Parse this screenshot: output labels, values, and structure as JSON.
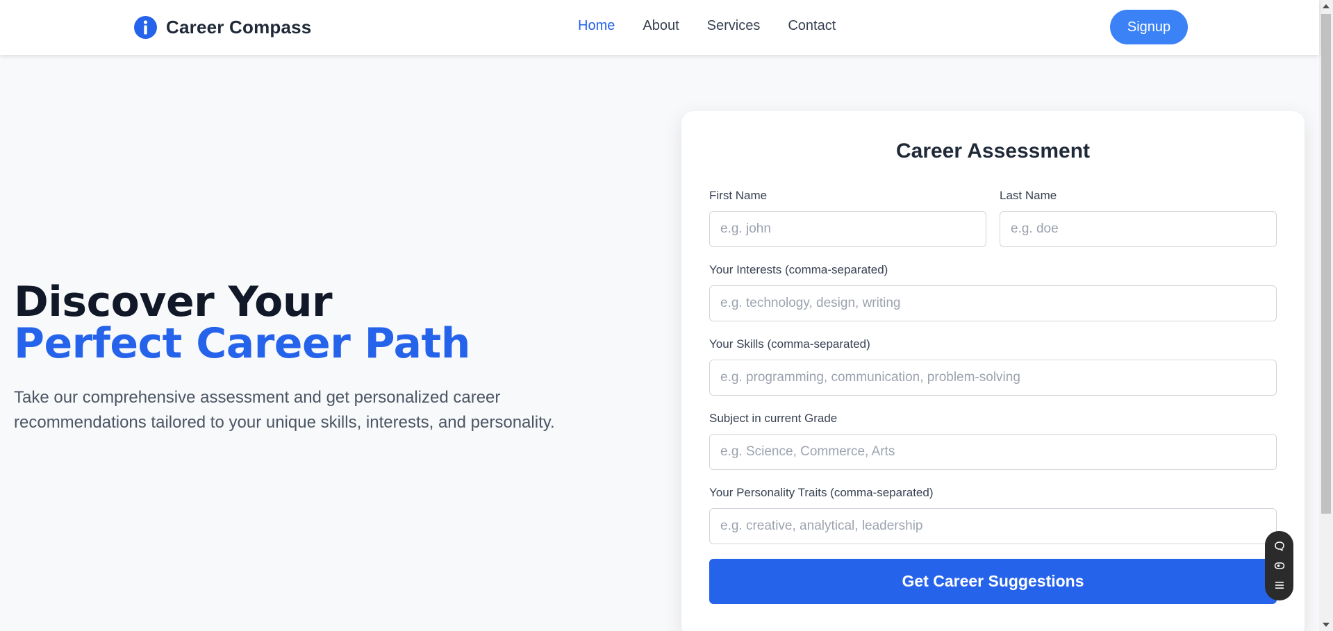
{
  "brand": {
    "name": "Career Compass",
    "accent": "#2563eb"
  },
  "nav": {
    "items": [
      "Home",
      "About",
      "Services",
      "Contact"
    ],
    "active": "Home"
  },
  "signup_label": "Signup",
  "hero": {
    "title_line1": "Discover Your",
    "title_line2": "Perfect Career Path",
    "description": "Take our comprehensive assessment and get personalized career recommendations tailored to your unique skills, interests, and personality."
  },
  "form": {
    "title": "Career Assessment",
    "first_name": {
      "label": "First Name",
      "placeholder": "e.g. john",
      "value": ""
    },
    "last_name": {
      "label": "Last Name",
      "placeholder": "e.g. doe",
      "value": ""
    },
    "interests": {
      "label": "Your Interests (comma-separated)",
      "placeholder": "e.g. technology, design, writing",
      "value": ""
    },
    "skills": {
      "label": "Your Skills (comma-separated)",
      "placeholder": "e.g. programming, communication, problem-solving",
      "value": ""
    },
    "subject": {
      "label": "Subject in current Grade",
      "placeholder": "e.g. Science, Commerce, Arts",
      "value": ""
    },
    "personality": {
      "label": "Your Personality Traits (comma-separated)",
      "placeholder": "e.g. creative, analytical, leadership",
      "value": ""
    },
    "submit_label": "Get Career Suggestions"
  },
  "widget": {
    "icons": [
      "chat-icon",
      "eye-icon",
      "menu-icon"
    ]
  }
}
